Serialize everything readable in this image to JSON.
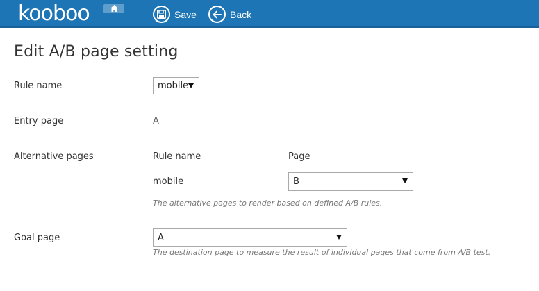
{
  "header": {
    "logo_text": "kooboo",
    "save_label": "Save",
    "back_label": "Back",
    "background_color": "#1d75b5"
  },
  "page": {
    "title": "Edit A/B page setting"
  },
  "form": {
    "rule_name": {
      "label": "Rule name",
      "selected": "mobile"
    },
    "entry_page": {
      "label": "Entry page",
      "value": "A"
    },
    "alternative_pages": {
      "label": "Alternative pages",
      "col_rule_name": "Rule name",
      "col_page": "Page",
      "rows": [
        {
          "rule": "mobile",
          "page": "B"
        }
      ],
      "help": "The alternative pages to render based on defined A/B rules."
    },
    "goal_page": {
      "label": "Goal page",
      "selected": "A",
      "help": "The destination page to measure the result of individual pages that come from A/B test."
    }
  }
}
